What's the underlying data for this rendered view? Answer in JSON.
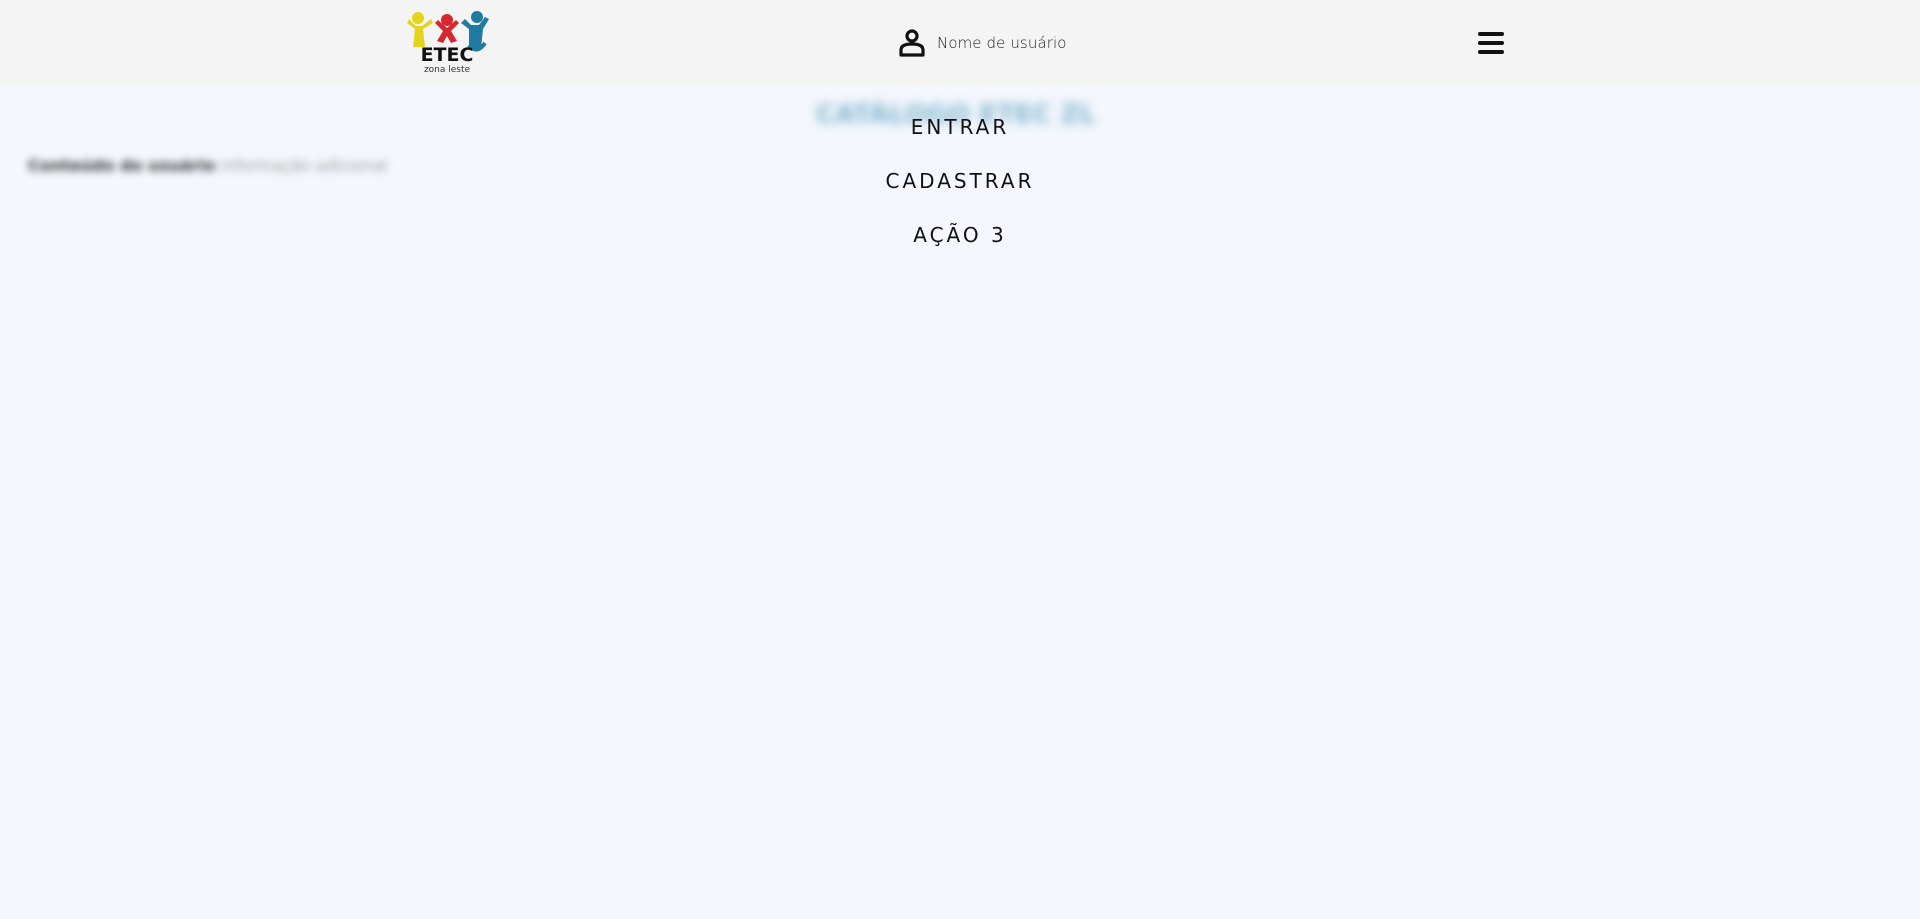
{
  "header": {
    "logo": {
      "title": "ETEC",
      "subtitle": "zona leste",
      "colors": {
        "yellow": "#e3d51b",
        "red": "#d6262e",
        "blue": "#1f7ba0"
      }
    },
    "user": {
      "icon": "user-icon",
      "name": "Nome de usuário"
    },
    "menu_icon": "hamburger-menu-icon"
  },
  "background": {
    "title": "CATÁLOGO ETEC ZL",
    "line_strong": "Conteúdo do usuário",
    "line_light": "informação adicional"
  },
  "menu": {
    "items": [
      {
        "label": "ENTRAR"
      },
      {
        "label": "CADASTRAR"
      },
      {
        "label": "AÇÃO 3"
      }
    ]
  }
}
